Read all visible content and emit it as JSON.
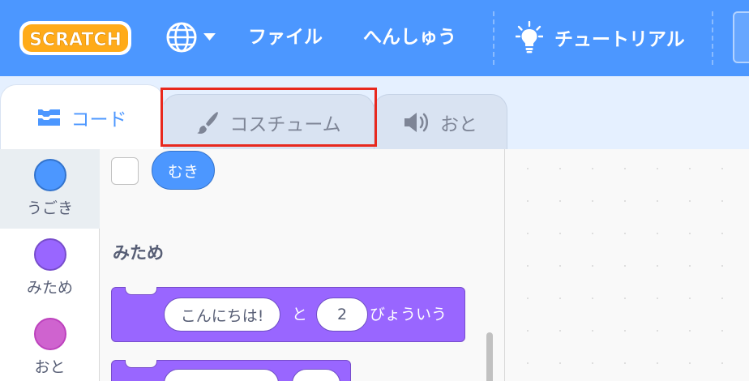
{
  "menubar": {
    "logo_text": "SCRATCH",
    "language_icon": "globe-icon",
    "file_label": "ファイル",
    "edit_label": "へんしゅう",
    "tutorial_label": "チュートリアル",
    "tutorial_icon": "lightbulb-icon",
    "background_color": "#4c97ff"
  },
  "tabs": [
    {
      "label": "コード",
      "icon": "code-blocks-icon",
      "active": true
    },
    {
      "label": "コスチューム",
      "icon": "paintbrush-icon",
      "active": false,
      "highlighted": true
    },
    {
      "label": "おと",
      "icon": "speaker-icon",
      "active": false
    }
  ],
  "categories": [
    {
      "label": "うごき",
      "color": "#4c97ff",
      "selected": true
    },
    {
      "label": "みため",
      "color": "#9966ff",
      "selected": false
    },
    {
      "label": "おと",
      "color": "#cf63cf",
      "selected": false
    }
  ],
  "palette": {
    "direction_reporter": "むき",
    "looks_section_title": "みため",
    "say_for_secs_block": {
      "message": "こんにちは!",
      "connector": "と",
      "seconds": "2",
      "suffix": "びょういう"
    }
  },
  "colors": {
    "highlight_box": "#e8281e",
    "motion": "#4c97ff",
    "looks": "#9966ff",
    "sound": "#cf63cf"
  }
}
